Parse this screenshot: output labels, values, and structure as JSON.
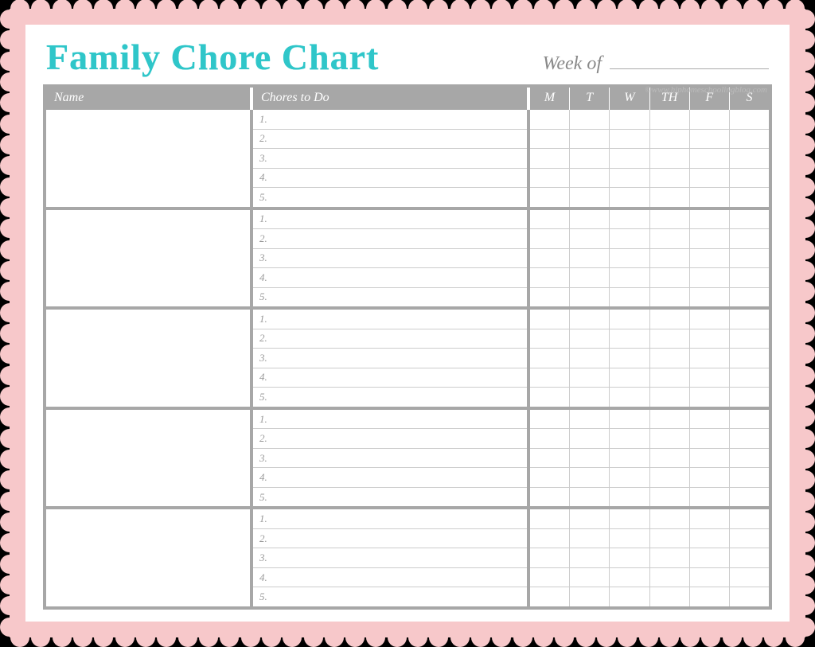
{
  "title": "Family Chore Chart",
  "week_of_label": "Week of",
  "credit": "©www.hiphomeschoolingblog.com",
  "columns": {
    "name": "Name",
    "chores": "Chores to Do",
    "days": [
      "M",
      "T",
      "W",
      "TH",
      "F",
      "S"
    ]
  },
  "chore_numbers": [
    "1.",
    "2.",
    "3.",
    "4.",
    "5."
  ],
  "person_count": 5
}
